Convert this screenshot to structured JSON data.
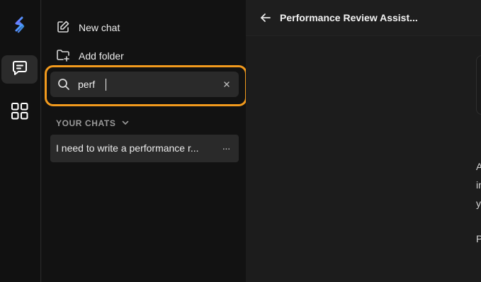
{
  "rail": {
    "logo": "logo-icon",
    "items": [
      {
        "name": "chat-bubble-icon",
        "active": true
      },
      {
        "name": "apps-grid-icon",
        "active": false
      }
    ]
  },
  "sidebar": {
    "new_chat_label": "New chat",
    "add_folder_label": "Add folder",
    "search": {
      "value": "perf",
      "placeholder": ""
    },
    "section_label": "YOUR CHATS",
    "chats": [
      {
        "title": "I need to write a performance r...",
        "more_label": "···"
      }
    ]
  },
  "main": {
    "title": "Performance Review Assist...",
    "clipped_text": [
      "A",
      "in",
      "y",
      "P"
    ]
  },
  "colors": {
    "highlight": "#f29a1d",
    "sidebar_bg": "#121212",
    "main_bg": "#1c1c1c"
  }
}
